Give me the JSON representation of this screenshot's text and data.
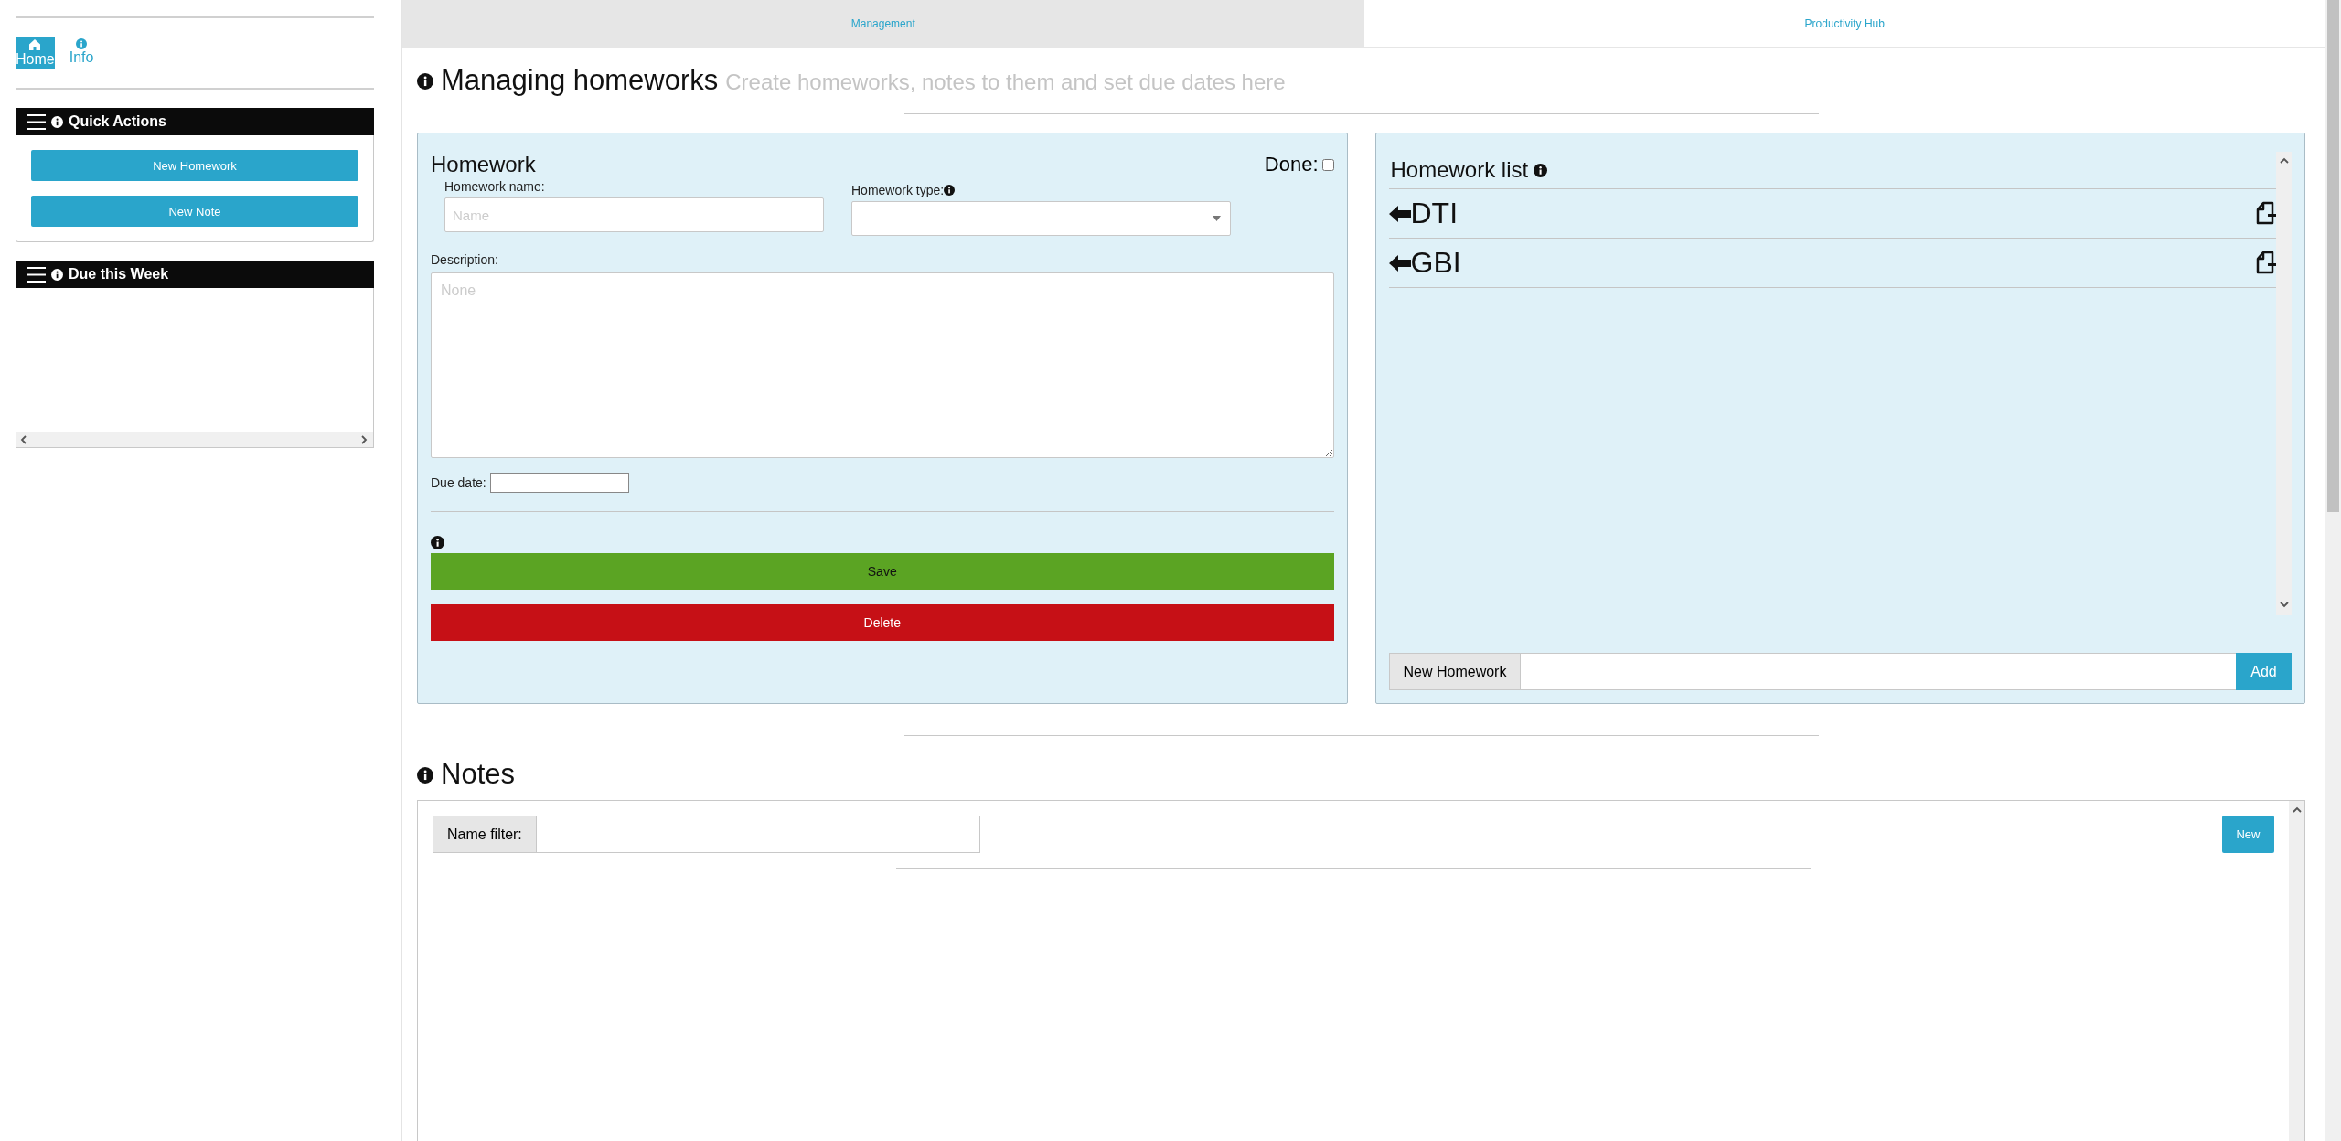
{
  "sidebar": {
    "nav": [
      {
        "label": "Home",
        "kind": "home",
        "selected": true
      },
      {
        "label": "Info",
        "kind": "info",
        "selected": false
      }
    ],
    "quick_actions": {
      "title": "Quick Actions",
      "buttons": [
        "New Homework",
        "New Note"
      ]
    },
    "due_this_week": {
      "title": "Due this Week"
    }
  },
  "tabs": [
    {
      "label": "Management",
      "selected": true
    },
    {
      "label": "Productivity Hub",
      "selected": false
    }
  ],
  "header": {
    "title": "Managing homeworks",
    "subtitle": "Create homeworks, notes to them and set due dates here"
  },
  "homework_form": {
    "title": "Homework",
    "done_label": "Done:",
    "done": false,
    "name_field": {
      "label": "Homework name:",
      "placeholder": "Name"
    },
    "type_label": "Homework type:",
    "description_field": {
      "label": "Description:",
      "placeholder": "None"
    },
    "due_label": "Due date:",
    "save": "Save",
    "delete": "Delete"
  },
  "homework_list": {
    "title": "Homework list",
    "items": [
      "DTI",
      "GBI"
    ],
    "new_label": "New Homework",
    "add": "Add"
  },
  "notes": {
    "title": "Notes",
    "filter_label": "Name filter:",
    "new": "New"
  }
}
